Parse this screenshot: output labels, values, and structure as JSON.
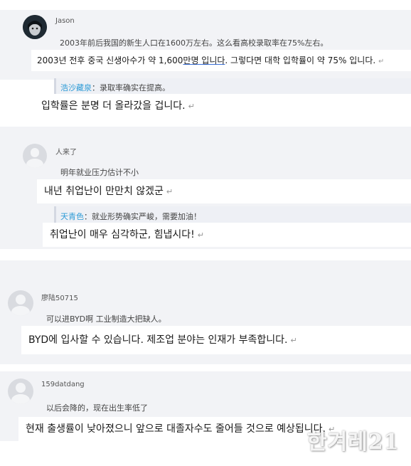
{
  "comments": [
    {
      "username": "Jason",
      "cn_text": "2003年前后我国的新生人口在1600万左右。这么看高校录取率在75%左右。",
      "ko_text_a": "2003년 전후 중국 신생아수가 약 1,600",
      "ko_text_u": "만명 입니다",
      "ko_text_b": ". 그렇다면 대학 입학률이 약 75% 입니다.",
      "reply_name": "浩沙藏泉",
      "reply_text": "：录取率确实在提高。",
      "reply_ko": "입학률은 분명 더 올라갔을 겁니다."
    },
    {
      "username": "人来了",
      "cn_text": "明年就业压力估计不小",
      "ko_text": "내년 취업난이 만만치 않겠군",
      "reply_name": "天青色",
      "reply_text": "：就业形势确实严峻，需要加油！",
      "reply_ko": "취업난이 매우 심각하군, 힘냅시다!"
    },
    {
      "username": "廖陆50715",
      "cn_text": "可以进BYD啊 工业制造大把缺人。",
      "ko_text": "BYD에 입사할 수 있습니다. 제조업 분야는 인재가 부족합니다."
    },
    {
      "username": "159datdang",
      "cn_text": "以后会降的，现在出生率低了",
      "ko_text": "현재 출생률이 낮아졌으니 앞으로 대졸자수도 줄어들 것으로 예상됩니다."
    }
  ],
  "return_mark": "↵",
  "watermark": "한겨레21"
}
